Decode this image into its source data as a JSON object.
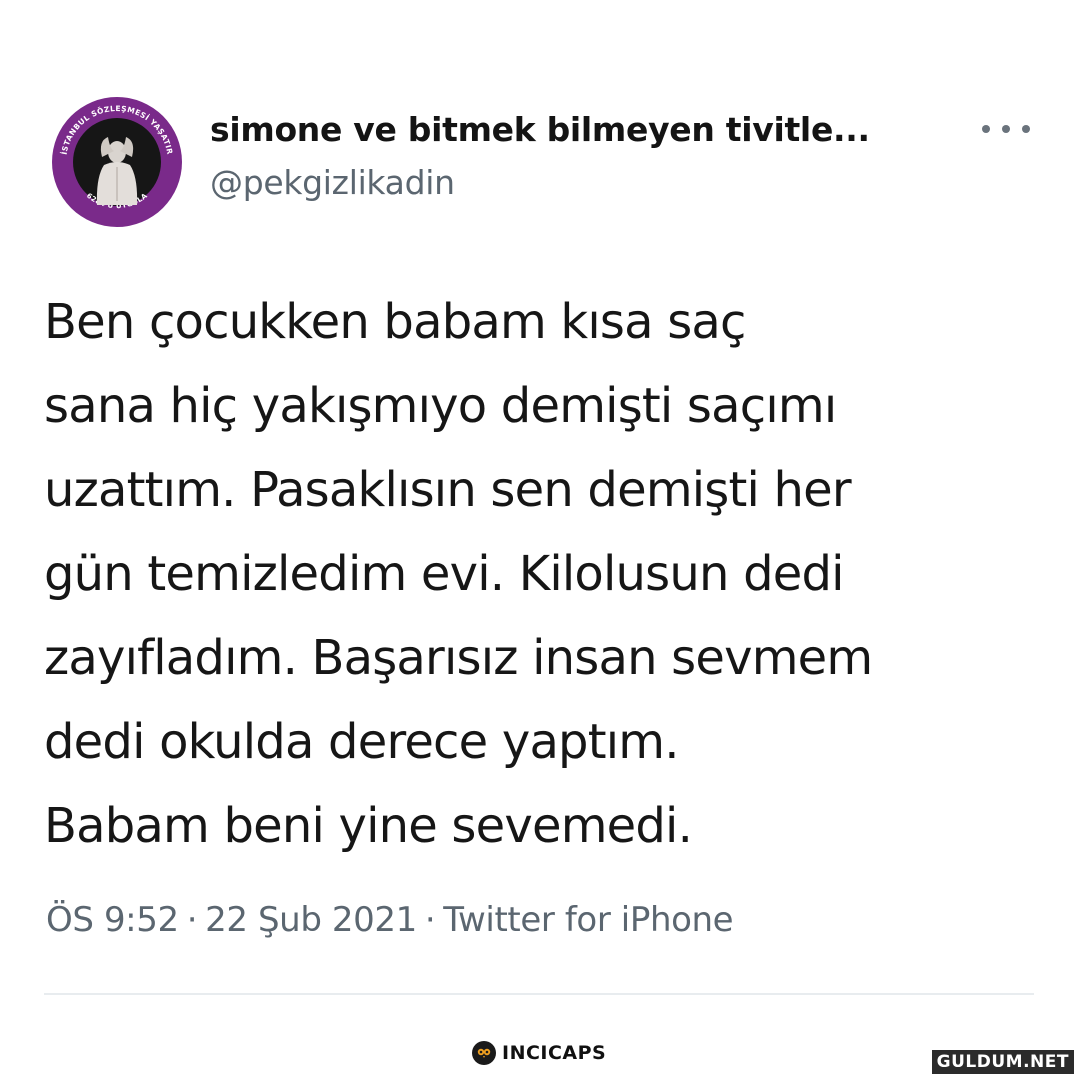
{
  "tweet": {
    "author": {
      "display_name": "simone ve bitmek bilmeyen tivitle...",
      "handle": "@pekgizlikadin",
      "avatar_ring_text": [
        "İSTANBUL SÖZLEŞMESİ YAŞATIR",
        "6284'Ü UYGULA"
      ],
      "avatar_ring_color": "#7a2a8a"
    },
    "more_icon": "more-horizontal-icon",
    "text_lines": [
      "Ben çocukken babam kısa saç",
      "sana hiç yakışmıyo demişti saçımı",
      "uzattım. Pasaklısın sen demişti her",
      "gün temizledim evi. Kilolusun dedi",
      "zayıfladım. Başarısız insan sevmem",
      "dedi okulda derece yaptım.",
      "Babam beni yine sevemedi."
    ],
    "time": "ÖS 9:52",
    "date": "22 Şub 2021",
    "source": "Twitter for iPhone",
    "separator": "·"
  },
  "branding": {
    "logo_text": "INCICAPS",
    "logo_icon": "owl-icon",
    "watermark": "GULDUM.NET"
  },
  "colors": {
    "text": "#161616",
    "secondary": "#5b6670",
    "divider": "#e8ecef",
    "avatar_ring": "#7a2a8a"
  }
}
